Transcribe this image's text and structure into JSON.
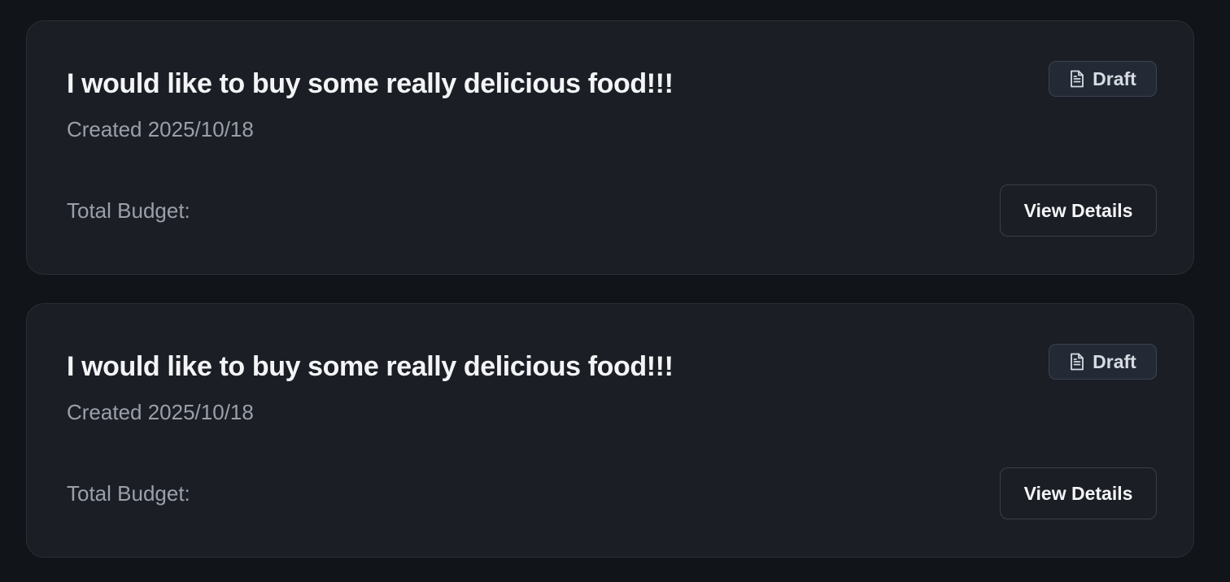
{
  "requests": [
    {
      "title": "I would like to buy some really delicious food!!!",
      "created": "Created 2025/10/18",
      "status": "Draft",
      "status_icon": "document-icon",
      "budget_label": "Total Budget:",
      "action_label": "View Details"
    },
    {
      "title": "I would like to buy some really delicious food!!!",
      "created": "Created 2025/10/18",
      "status": "Draft",
      "status_icon": "document-icon",
      "budget_label": "Total Budget:",
      "action_label": "View Details"
    }
  ],
  "colors": {
    "page_background": "#111418",
    "card_background": "#1b1e25",
    "badge_background": "#232a36",
    "muted_text": "#9aa0aa",
    "primary_text": "#f3f4f6"
  }
}
